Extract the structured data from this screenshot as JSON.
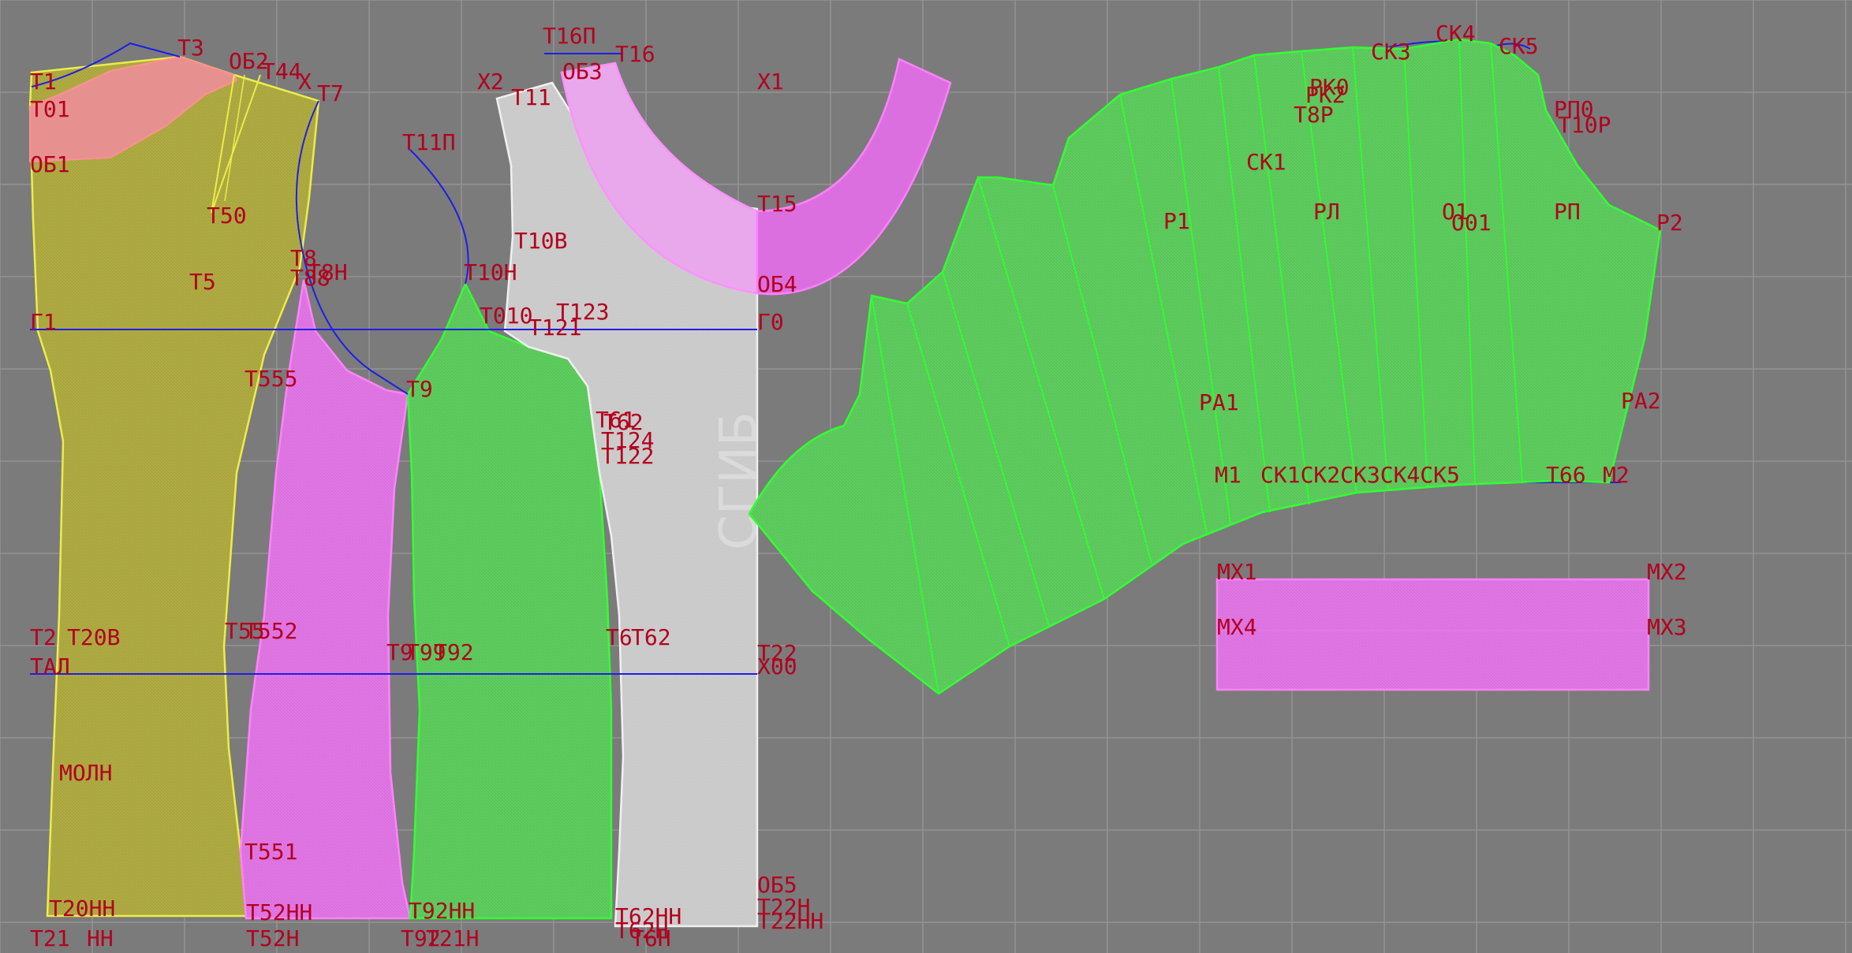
{
  "colors": {
    "background": "#7b7b7b",
    "grid": "#9a9a9a",
    "construction_line": "#1e1ee6",
    "label": "#b3001e",
    "piece_yellow": "#a9a53a",
    "piece_yellow_stroke": "#ecec48",
    "piece_green": "#56c756",
    "piece_green_stroke": "#2fff2f",
    "piece_magenta": "#dc6fe0",
    "piece_magenta_stroke": "#ff80ff",
    "piece_white": "#c9c9c9",
    "piece_white_stroke": "#f0f0f0",
    "piece_pink": "#e79090"
  },
  "pieces": {
    "back": {
      "name": "back-piece"
    },
    "back_side": {
      "name": "back-side-piece"
    },
    "front_side": {
      "name": "front-side-piece"
    },
    "front": {
      "name": "front-piece",
      "fold_text": "СГИБ"
    },
    "facing": {
      "name": "neck-facing-piece"
    },
    "sleeve": {
      "name": "sleeve-piece"
    },
    "cuff": {
      "name": "cuff-piece"
    }
  },
  "labels": {
    "t1": "Т1",
    "t01": "Т01",
    "ob1": "ОБ1",
    "t3": "Т3",
    "ob2": "ОБ2",
    "t44": "Т44",
    "x7": "Х",
    "t7": "Т7",
    "t50": "Т50",
    "t5": "Т5",
    "t8": "Т8",
    "t8n": "Т8Н",
    "t88": "Т88",
    "g1": "Г1",
    "t555": "Т555",
    "t9": "Т9",
    "t11p": "Т11П",
    "t10n": "Т10Н",
    "t16p": "Т16П",
    "t16": "Т16",
    "x2": "Х2",
    "t11": "Т11",
    "ob3": "ОБ3",
    "x1": "Х1",
    "t15": "Т15",
    "t10v": "Т10В",
    "ob4": "ОБ4",
    "t010": "Т010",
    "t121": "Т121",
    "t123": "Т123",
    "g0": "Г0",
    "t61": "Т61",
    "t62": "Т62",
    "t124": "Т124",
    "t122": "Т122",
    "t2": "Т2",
    "t20v": "Т20В",
    "t55": "Т55",
    "t552": "Т552",
    "t9l": "Т9",
    "t99": "Т99",
    "t92": "Т92",
    "t6": "Т6",
    "t62b": "Т62",
    "t22": "Т22",
    "tal": "ТАЛ",
    "x00": "Х00",
    "moln": "МОЛН",
    "t551": "Т551",
    "ob5": "ОБ5",
    "t20nn": "Т20НН",
    "t52nn": "Т52НН",
    "t92nn": "Т92НН",
    "t62nn": "Т62НН",
    "t22n": "Т22Н",
    "t22nn": "Т22НН",
    "t21": "Т21",
    "nn": "НН",
    "t52n": "Т52Н",
    "t921": "Т92",
    "t21b": "Т21Н",
    "t62n": "Т62Н",
    "t6h": "Т6Н",
    "ck4": "СК4",
    "ck5": "СК5",
    "ck3": "СК3",
    "rk2": "РК2",
    "rko": "РК0",
    "rp0": "РП0",
    "t8r": "Т8Р",
    "t10r": "Т10Р",
    "ck1": "СК1",
    "r1": "Р1",
    "rl": "РЛ",
    "o1": "О1",
    "o01": "О01",
    "rp": "РП",
    "r2": "Р2",
    "ra1": "РА1",
    "ra2": "РА2",
    "m1": "М1",
    "m_row": "СК1СК2СК3СК4СК5",
    "m6": "Т66",
    "m2": "М2",
    "mx1": "МХ1",
    "mx2": "МХ2",
    "mx4": "МХ4",
    "mx3": "МХ3"
  }
}
